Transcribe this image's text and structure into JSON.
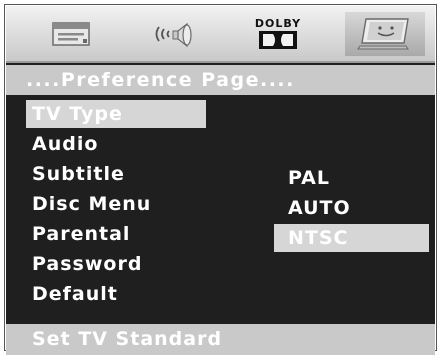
{
  "header": {
    "tabs": [
      {
        "icon": "general-setup-icon"
      },
      {
        "icon": "audio-speaker-icon"
      },
      {
        "icon": "dolby-digital-icon",
        "label": "DOLBY"
      },
      {
        "icon": "preference-tv-icon",
        "selected": true
      }
    ]
  },
  "page": {
    "title": "....Preference Page...."
  },
  "menu": {
    "items": [
      {
        "label": "TV Type",
        "selected": true
      },
      {
        "label": "Audio"
      },
      {
        "label": "Subtitle"
      },
      {
        "label": "Disc Menu"
      },
      {
        "label": "Parental"
      },
      {
        "label": "Password"
      },
      {
        "label": "Default"
      }
    ]
  },
  "options": {
    "items": [
      {
        "label": "PAL"
      },
      {
        "label": "AUTO"
      },
      {
        "label": "NTSC",
        "selected": true
      }
    ]
  },
  "status": {
    "text": "Set TV Standard"
  },
  "colors": {
    "background": "#1f1f1f",
    "bar": "#c9c9c9",
    "highlight": "#d6d6d6",
    "text": "#ffffff"
  }
}
